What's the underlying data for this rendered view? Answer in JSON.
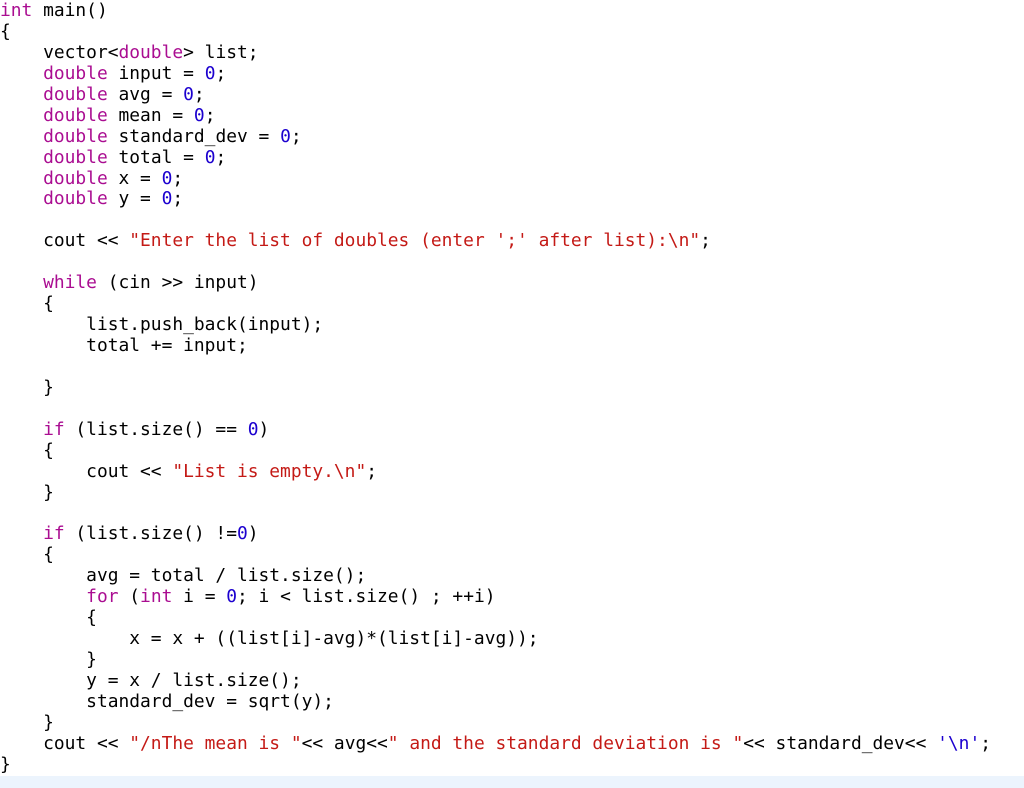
{
  "editor": {
    "language": "C++",
    "colors": {
      "keyword": "#AA0D91",
      "number": "#1C00CF",
      "string": "#C41A16",
      "char": "#1C00CF",
      "plain": "#000000",
      "highlight_band": "#ECF4FD"
    },
    "lines": [
      [
        [
          "kw",
          "int"
        ],
        [
          "plain",
          " main()"
        ]
      ],
      [
        [
          "plain",
          "{"
        ]
      ],
      [
        [
          "plain",
          "    vector<"
        ],
        [
          "kw",
          "double"
        ],
        [
          "plain",
          "> list;"
        ]
      ],
      [
        [
          "plain",
          "    "
        ],
        [
          "kw",
          "double"
        ],
        [
          "plain",
          " input = "
        ],
        [
          "num",
          "0"
        ],
        [
          "plain",
          ";"
        ]
      ],
      [
        [
          "plain",
          "    "
        ],
        [
          "kw",
          "double"
        ],
        [
          "plain",
          " avg = "
        ],
        [
          "num",
          "0"
        ],
        [
          "plain",
          ";"
        ]
      ],
      [
        [
          "plain",
          "    "
        ],
        [
          "kw",
          "double"
        ],
        [
          "plain",
          " mean = "
        ],
        [
          "num",
          "0"
        ],
        [
          "plain",
          ";"
        ]
      ],
      [
        [
          "plain",
          "    "
        ],
        [
          "kw",
          "double"
        ],
        [
          "plain",
          " standard_dev = "
        ],
        [
          "num",
          "0"
        ],
        [
          "plain",
          ";"
        ]
      ],
      [
        [
          "plain",
          "    "
        ],
        [
          "kw",
          "double"
        ],
        [
          "plain",
          " total = "
        ],
        [
          "num",
          "0"
        ],
        [
          "plain",
          ";"
        ]
      ],
      [
        [
          "plain",
          "    "
        ],
        [
          "kw",
          "double"
        ],
        [
          "plain",
          " x = "
        ],
        [
          "num",
          "0"
        ],
        [
          "plain",
          ";"
        ]
      ],
      [
        [
          "plain",
          "    "
        ],
        [
          "kw",
          "double"
        ],
        [
          "plain",
          " y = "
        ],
        [
          "num",
          "0"
        ],
        [
          "plain",
          ";"
        ]
      ],
      [],
      [
        [
          "plain",
          "    cout << "
        ],
        [
          "str",
          "\"Enter the list of doubles (enter ';' after list):\\n\""
        ],
        [
          "plain",
          ";"
        ]
      ],
      [],
      [
        [
          "plain",
          "    "
        ],
        [
          "kw",
          "while"
        ],
        [
          "plain",
          " (cin >> input)"
        ]
      ],
      [
        [
          "plain",
          "    {"
        ]
      ],
      [
        [
          "plain",
          "        list.push_back(input);"
        ]
      ],
      [
        [
          "plain",
          "        total += input;"
        ]
      ],
      [],
      [
        [
          "plain",
          "    }"
        ]
      ],
      [],
      [
        [
          "plain",
          "    "
        ],
        [
          "kw",
          "if"
        ],
        [
          "plain",
          " (list.size() == "
        ],
        [
          "num",
          "0"
        ],
        [
          "plain",
          ")"
        ]
      ],
      [
        [
          "plain",
          "    {"
        ]
      ],
      [
        [
          "plain",
          "        cout << "
        ],
        [
          "str",
          "\"List is empty.\\n\""
        ],
        [
          "plain",
          ";"
        ]
      ],
      [
        [
          "plain",
          "    }"
        ]
      ],
      [],
      [
        [
          "plain",
          "    "
        ],
        [
          "kw",
          "if"
        ],
        [
          "plain",
          " (list.size() !="
        ],
        [
          "num",
          "0"
        ],
        [
          "plain",
          ")"
        ]
      ],
      [
        [
          "plain",
          "    {"
        ]
      ],
      [
        [
          "plain",
          "        avg = total / list.size();"
        ]
      ],
      [
        [
          "plain",
          "        "
        ],
        [
          "kw",
          "for"
        ],
        [
          "plain",
          " ("
        ],
        [
          "kw",
          "int"
        ],
        [
          "plain",
          " i = "
        ],
        [
          "num",
          "0"
        ],
        [
          "plain",
          "; i < list.size() ; ++i)"
        ]
      ],
      [
        [
          "plain",
          "        {"
        ]
      ],
      [
        [
          "plain",
          "            x = x + ((list[i]-avg)*(list[i]-avg));"
        ]
      ],
      [
        [
          "plain",
          "        }"
        ]
      ],
      [
        [
          "plain",
          "        y = x / list.size();"
        ]
      ],
      [
        [
          "plain",
          "        standard_dev = sqrt(y);"
        ]
      ],
      [
        [
          "plain",
          "    }"
        ]
      ],
      [
        [
          "plain",
          "    cout << "
        ],
        [
          "str",
          "\"/nThe mean is \""
        ],
        [
          "plain",
          "<< avg<<"
        ],
        [
          "str",
          "\" and the standard deviation is \""
        ],
        [
          "plain",
          "<< standard_dev<< "
        ],
        [
          "chr",
          "'\\n'"
        ],
        [
          "plain",
          ";"
        ]
      ],
      [
        [
          "plain",
          "}"
        ]
      ]
    ]
  }
}
